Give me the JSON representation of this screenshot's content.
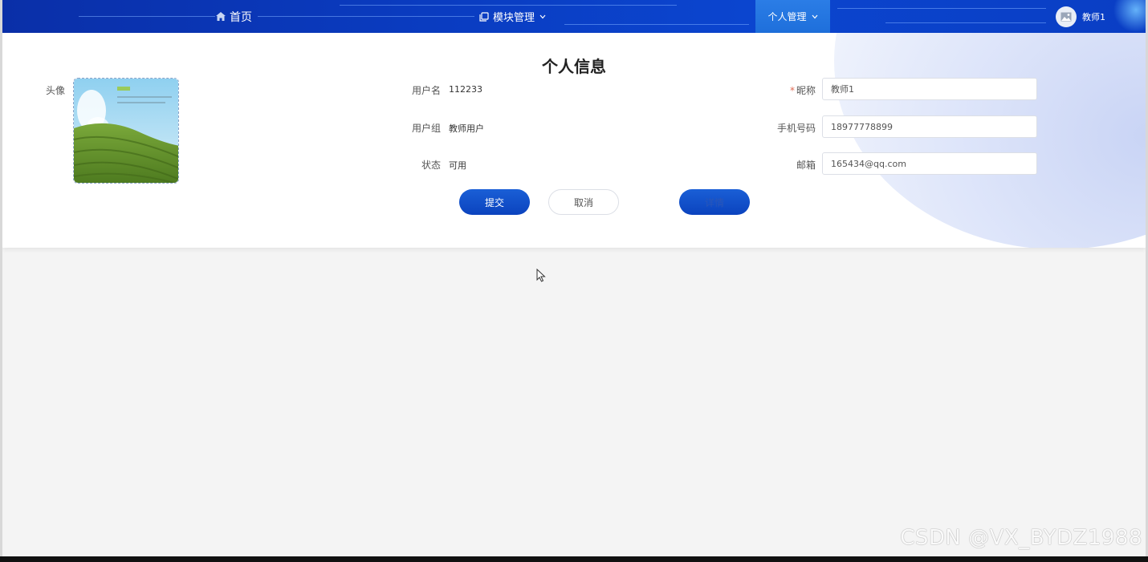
{
  "nav": {
    "home_label": "首页",
    "modules_label": "模块管理",
    "personal_label": "个人管理",
    "user_name": "教师1"
  },
  "profile": {
    "title": "个人信息",
    "avatar_label": "头像",
    "username_label": "用户名",
    "username_value": "112233",
    "group_label": "用户组",
    "group_value": "教师用户",
    "status_label": "状态",
    "status_value": "可用",
    "nickname_required_mark": "*",
    "nickname_label": "昵称",
    "nickname_value": "教师1",
    "phone_label": "手机号码",
    "phone_value": "18977778899",
    "email_label": "邮箱",
    "email_value": "165434@qq.com"
  },
  "actions": {
    "submit_label": "提交",
    "cancel_label": "取消",
    "detail_label": "详情"
  },
  "watermark": "CSDN @VX_BYDZ1988",
  "colors": {
    "nav_bg": "#0a3bbf",
    "nav_active": "#1e6fdb",
    "primary_button": "#0b43be",
    "required_mark": "#e06a54"
  }
}
